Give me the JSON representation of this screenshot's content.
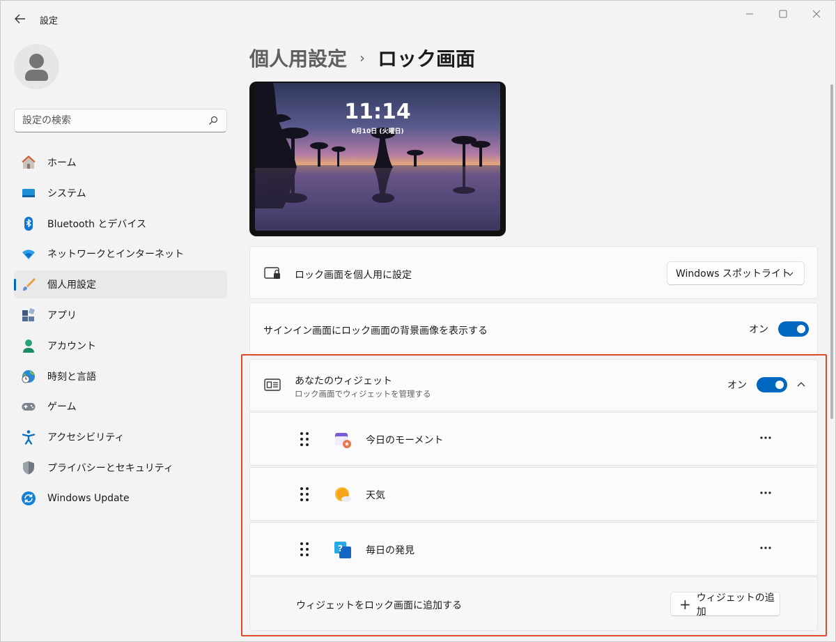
{
  "window": {
    "title": "設定",
    "controls": {
      "minimize": "—",
      "maximize": "☐",
      "close": "✕"
    }
  },
  "sidebar": {
    "search_placeholder": "設定の検索",
    "items": [
      {
        "label": "ホーム",
        "icon": "home-icon"
      },
      {
        "label": "システム",
        "icon": "system-icon"
      },
      {
        "label": "Bluetooth とデバイス",
        "icon": "bluetooth-icon"
      },
      {
        "label": "ネットワークとインターネット",
        "icon": "network-icon"
      },
      {
        "label": "個人用設定",
        "icon": "personalization-icon",
        "active": true
      },
      {
        "label": "アプリ",
        "icon": "apps-icon"
      },
      {
        "label": "アカウント",
        "icon": "account-icon"
      },
      {
        "label": "時刻と言語",
        "icon": "time-language-icon"
      },
      {
        "label": "ゲーム",
        "icon": "gaming-icon"
      },
      {
        "label": "アクセシビリティ",
        "icon": "accessibility-icon"
      },
      {
        "label": "プライバシーとセキュリティ",
        "icon": "privacy-icon"
      },
      {
        "label": "Windows Update",
        "icon": "windows-update-icon"
      }
    ]
  },
  "breadcrumb": {
    "parent": "個人用設定",
    "separator": "›",
    "current": "ロック画面"
  },
  "preview": {
    "time": "11:14",
    "date": "6月10日 (火曜日)"
  },
  "settings": {
    "personalize": {
      "label": "ロック画面を個人用に設定",
      "dropdown_value": "Windows スポットライト"
    },
    "signin_background": {
      "label": "サインイン画面にロック画面の背景画像を表示する",
      "state": "オン"
    },
    "widgets": {
      "title": "あなたのウィジェット",
      "subtitle": "ロック画面でウィジェットを管理する",
      "state": "オン",
      "items": [
        {
          "label": "今日のモーメント",
          "icon": "moment-calendar-icon"
        },
        {
          "label": "天気",
          "icon": "weather-sun-icon"
        },
        {
          "label": "毎日の発見",
          "icon": "discovery-question-icon"
        }
      ],
      "add_label": "ウィジェットをロック画面に追加する",
      "add_button": "ウィジェットの追加"
    }
  },
  "colors": {
    "accent": "#0067c0",
    "highlight_border": "#e04a2c"
  }
}
